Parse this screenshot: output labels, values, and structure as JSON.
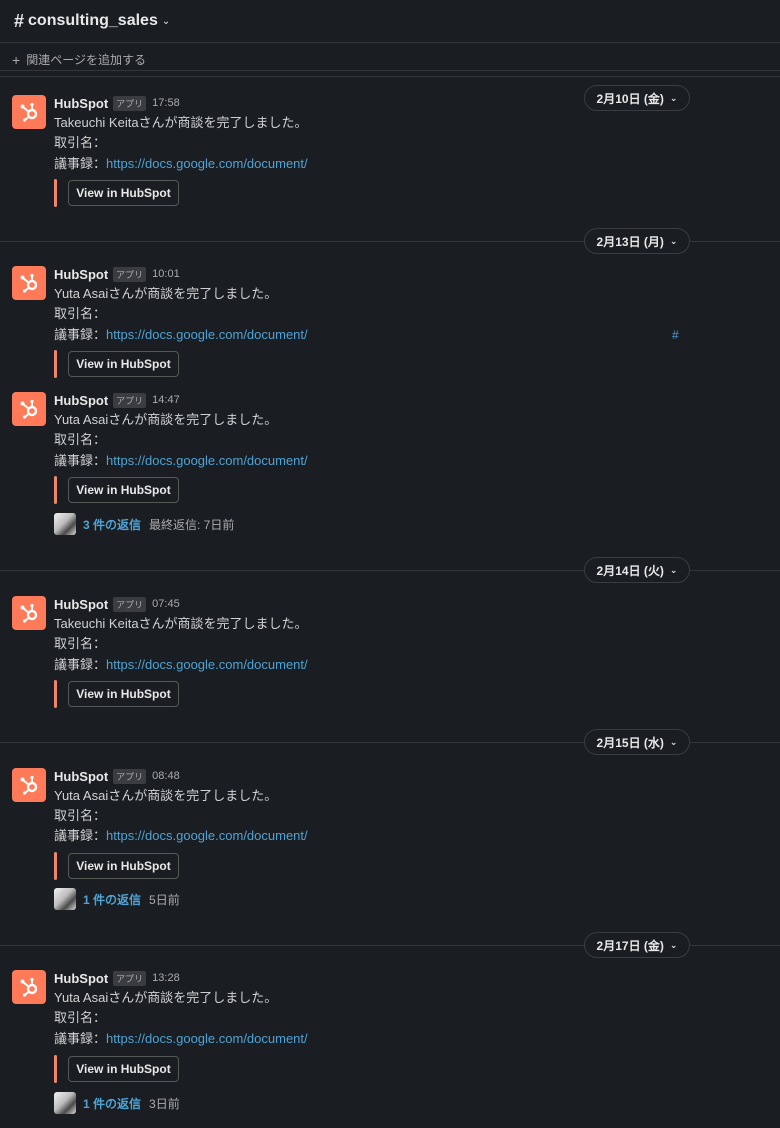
{
  "channel": {
    "hash": "#",
    "name": "consulting_sales"
  },
  "bookmark": {
    "plus": "+",
    "label": "関連ページを追加する"
  },
  "common": {
    "sender": "HubSpot",
    "app_badge": "アプリ",
    "deal_label": "取引名：",
    "minutes_label": "議事録：",
    "link_text": "https://docs.google.com/document/",
    "button_label": "View in HubSpot",
    "hash_link": "#",
    "brand_color": "#ff7a59"
  },
  "days": [
    {
      "date": "2月10日 (金)"
    },
    {
      "date": "2月13日 (月)"
    },
    {
      "date": "2月14日 (火)"
    },
    {
      "date": "2月15日 (水)"
    },
    {
      "date": "2月17日 (金)"
    }
  ],
  "messages": [
    {
      "time": "17:58",
      "text": "Takeuchi Keitaさんが商談を完了しました。"
    },
    {
      "time": "10:01",
      "text": "Yuta Asaiさんが商談を完了しました。"
    },
    {
      "time": "14:47",
      "text": "Yuta Asaiさんが商談を完了しました。",
      "thread": {
        "count": "3 件の返信",
        "last": "最終返信: 7日前"
      }
    },
    {
      "time": "07:45",
      "text": "Takeuchi Keitaさんが商談を完了しました。"
    },
    {
      "time": "08:48",
      "text": "Yuta Asaiさんが商談を完了しました。",
      "thread": {
        "count": "1 件の返信",
        "last": "5日前"
      }
    },
    {
      "time": "13:28",
      "text": "Yuta Asaiさんが商談を完了しました。",
      "thread": {
        "count": "1 件の返信",
        "last": "3日前"
      }
    }
  ]
}
